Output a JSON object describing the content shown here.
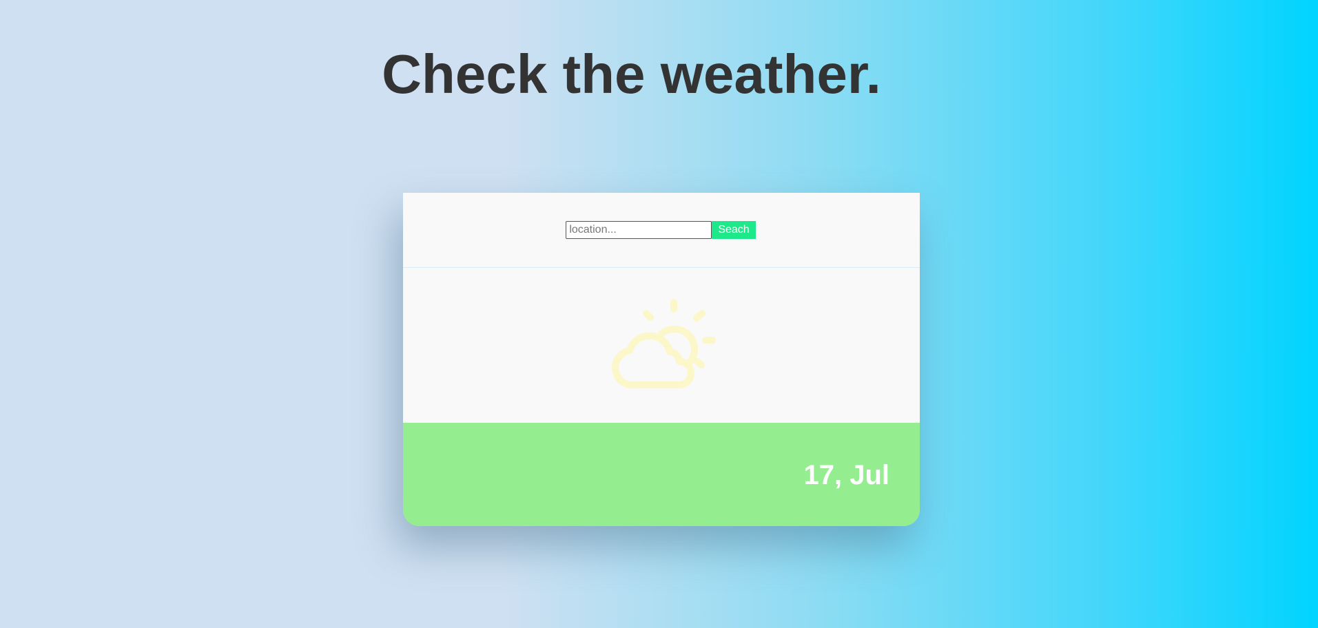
{
  "header": {
    "title": "Check the weather."
  },
  "search": {
    "placeholder": "location...",
    "value": "",
    "button_label": "Seach"
  },
  "weather": {
    "icon": "partly-cloudy-icon",
    "icon_color": "#fbf7c8"
  },
  "footer": {
    "date": "17, Jul",
    "background_color": "#94ed8f"
  },
  "colors": {
    "search_button": "#1de98b",
    "title_text": "#333333"
  }
}
